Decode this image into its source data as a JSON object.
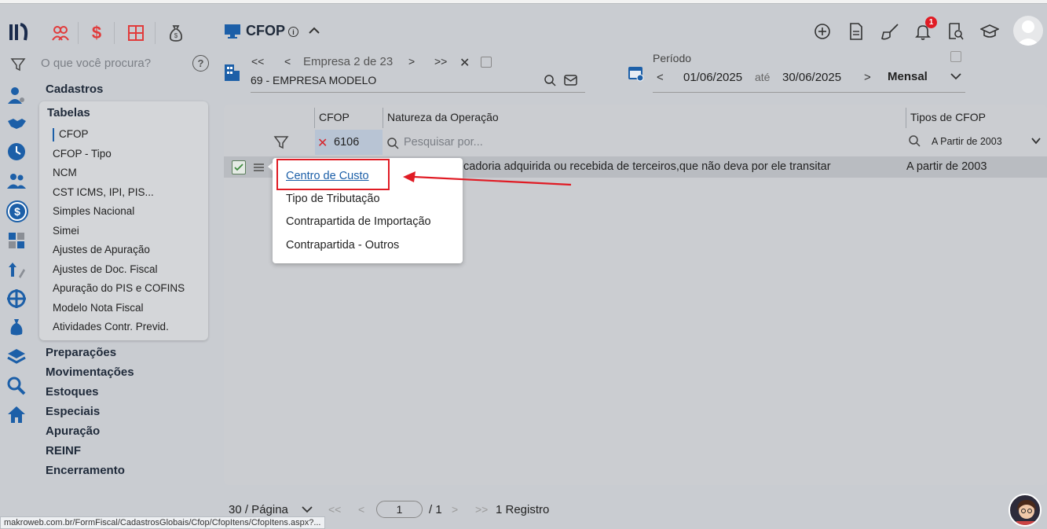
{
  "header": {
    "page_title": "CFOP",
    "search_placeholder": "O que você procura?"
  },
  "company": {
    "nav_label": "Empresa 2 de 23",
    "name": "69 - EMPRESA MODELO"
  },
  "period": {
    "label": "Período",
    "start": "01/06/2025",
    "until": "até",
    "end": "30/06/2025",
    "mode": "Mensal"
  },
  "notifications": {
    "count": "1"
  },
  "sidebar": {
    "sections": {
      "cadastros": "Cadastros",
      "tabelas": "Tabelas",
      "preparacoes": "Preparações",
      "movimentacoes": "Movimentações",
      "estoques": "Estoques",
      "especiais": "Especiais",
      "apuracao": "Apuração",
      "reinf": "REINF",
      "encerramento": "Encerramento"
    },
    "tabelas_items": [
      "CFOP",
      "CFOP - Tipo",
      "NCM",
      "CST ICMS, IPI, PIS...",
      "Simples Nacional",
      "Simei",
      "Ajustes de Apuração",
      "Ajustes de Doc. Fiscal",
      "Apuração do PIS e COFINS",
      "Modelo Nota Fiscal",
      "Atividades Contr. Previd."
    ]
  },
  "grid": {
    "columns": {
      "cfop": "CFOP",
      "natureza": "Natureza da Operação",
      "tipos": "Tipos de CFOP"
    },
    "filter_cfop_value": "6106",
    "search_placeholder": "Pesquisar por...",
    "tipos_filter_value": "A Partir de 2003",
    "rows": [
      {
        "natureza": "cadoria adquirida ou recebida de terceiros,que não deva por ele transitar",
        "tipo": "A partir de 2003"
      }
    ]
  },
  "context_menu": {
    "items": [
      "Centro de Custo",
      "Tipo de Tributação",
      "Contrapartida de Importação",
      "Contrapartida - Outros"
    ]
  },
  "pagination": {
    "per_page": "30 / Página",
    "current_page": "1",
    "total_pages": "/ 1",
    "records": "1 Registro"
  },
  "status_bar": {
    "url": "makroweb.com.br/FormFiscal/CadastrosGlobais/Cfop/CfopItens/CfopItens.aspx?..."
  },
  "colors": {
    "accent_blue": "#1c5fa8",
    "highlight_red": "#e01b24",
    "page_bg": "#c9ccd1"
  }
}
